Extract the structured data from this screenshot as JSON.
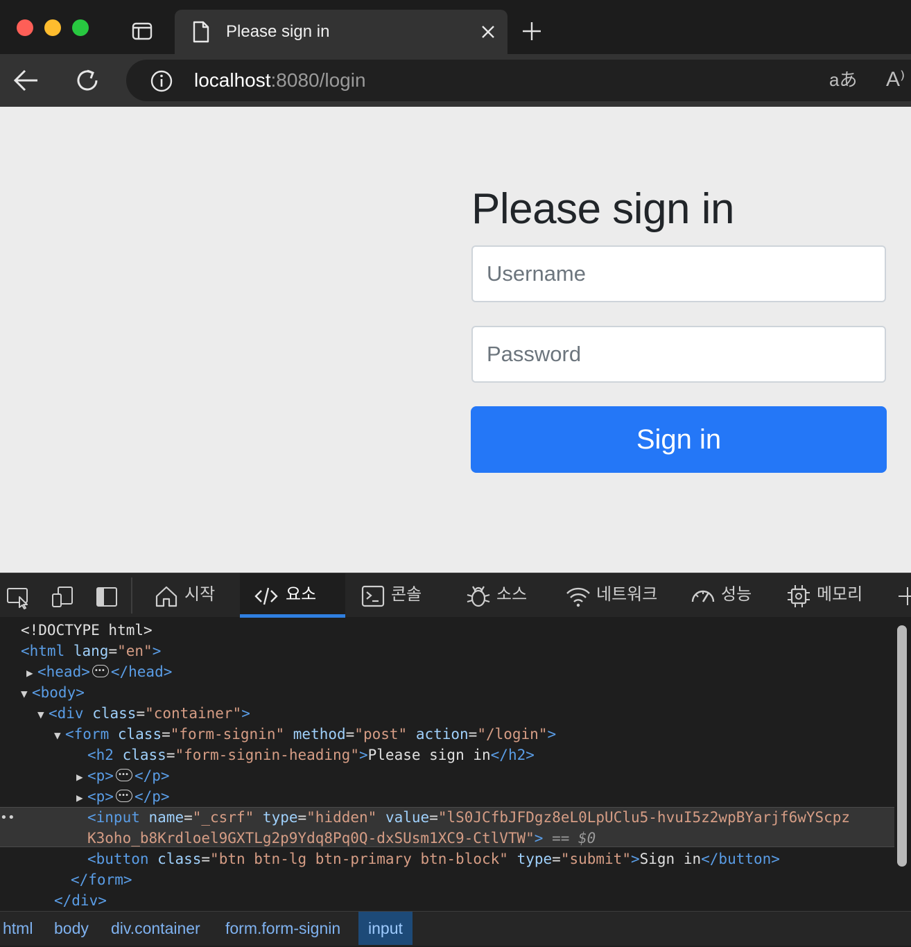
{
  "browser": {
    "tab_title": "Please sign in",
    "url_host": "localhost",
    "url_rest": ":8080/login",
    "traffic_light_colors": [
      "#fe5f57",
      "#febc2e",
      "#28c840"
    ],
    "icons": [
      "sidebar-icon",
      "page-icon",
      "close-icon",
      "plus-icon",
      "back-arrow-icon",
      "refresh-icon",
      "info-icon",
      "translate-icon",
      "read-aloud-icon"
    ]
  },
  "page": {
    "heading": "Please sign in",
    "username_placeholder": "Username",
    "password_placeholder": "Password",
    "signin_label": "Sign in",
    "button_color": "#2477f7"
  },
  "devtools": {
    "tabs": [
      {
        "label": "시작"
      },
      {
        "label": "요소"
      },
      {
        "label": "콘솔"
      },
      {
        "label": "소스"
      },
      {
        "label": "네트워크"
      },
      {
        "label": "성능"
      },
      {
        "label": "메모리"
      }
    ],
    "dom": {
      "doctype": "<!DOCTYPE html>",
      "html_tag": "<html",
      "lang_attr": "lang",
      "lang_val": "\"en\"",
      "head_open": "<head>",
      "head_close": "</head>",
      "body_open": "<body>",
      "div_open": "<div",
      "div_class": "\"container\"",
      "form_open": "<form",
      "form_class": "\"form-signin\"",
      "form_method": "\"post\"",
      "form_action": "\"/login\"",
      "h2_open": "<h2",
      "h2_class": "\"form-signin-heading\"",
      "h2_text": "Please sign in",
      "h2_close": "</h2>",
      "p_open": "<p>",
      "p_close": "</p>",
      "input_open": "<input",
      "input_name": "\"_csrf\"",
      "input_type": "\"hidden\"",
      "input_value_1": "\"lS0JCfbJFDgz8eL0LpUClu5-hvuI5z2wpBYarjf6wYScpz",
      "input_value_2": "K3oho_b8Krdloel9GXTLg2p9Ydq8Pq0Q-dxSUsm1XC9-CtlVTW\"",
      "selected_marker": "== $0",
      "button_open": "<button",
      "button_class": "\"btn btn-lg btn-primary btn-block\"",
      "button_type": "\"submit\"",
      "button_text": "Sign in",
      "button_close": "</button>",
      "form_close": "</form>",
      "div_close": "</div>"
    },
    "breadcrumbs": {
      "html": "html",
      "body": "body",
      "div_tag": "div",
      "div_class": ".container",
      "form_tag": "form",
      "form_class": ".form-signin",
      "input": "input"
    }
  }
}
